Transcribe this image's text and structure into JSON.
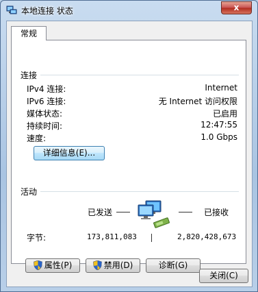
{
  "window": {
    "title": "本地连接 状态",
    "close_label": "x"
  },
  "tab": {
    "label": "常规"
  },
  "connection": {
    "heading": "连接",
    "rows": [
      {
        "label": "IPv4 连接:",
        "value": "Internet"
      },
      {
        "label": "IPv6 连接:",
        "value": "无 Internet 访问权限"
      },
      {
        "label": "媒体状态:",
        "value": "已启用"
      },
      {
        "label": "持续时间:",
        "value": "12:47:55"
      },
      {
        "label": "速度:",
        "value": "1.0 Gbps"
      }
    ],
    "details_button": "详细信息(E)..."
  },
  "activity": {
    "heading": "活动",
    "sent_label": "已发送",
    "received_label": "已接收",
    "bytes_label": "字节:",
    "bytes_sent": "173,811,083",
    "bytes_received": "2,820,428,673"
  },
  "buttons": {
    "properties": "属性(P)",
    "disable": "禁用(D)",
    "diagnose": "诊断(G)",
    "close": "关闭(C)"
  },
  "icons": {
    "title": "network-connection-icon",
    "activity": "network-computers-icon",
    "shield": "uac-shield-icon"
  }
}
